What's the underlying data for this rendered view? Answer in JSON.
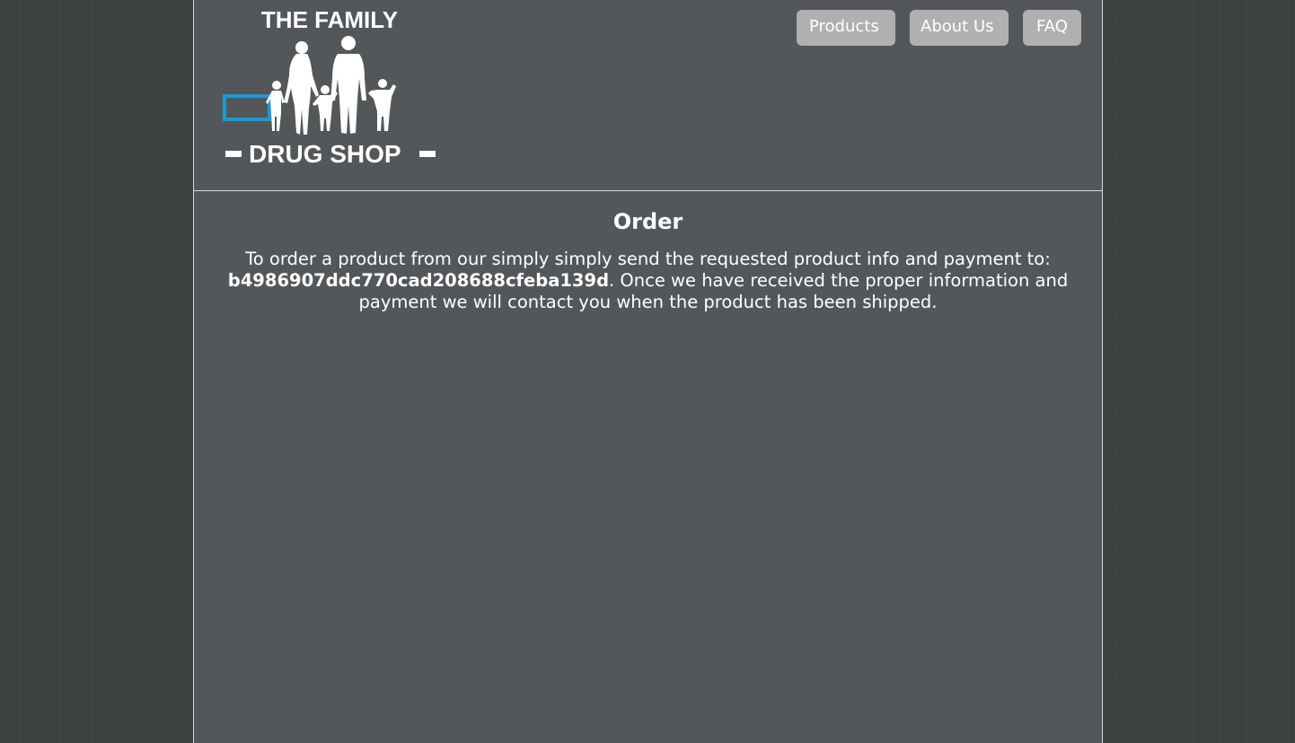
{
  "logo": {
    "line_top": "THE FAMILY",
    "line_bottom": "DRUG SHOP",
    "accent_color": "#1a9ad6"
  },
  "nav": {
    "items": [
      {
        "label": "Products"
      },
      {
        "label": "About Us"
      },
      {
        "label": "FAQ"
      }
    ]
  },
  "main": {
    "heading": "Order",
    "text_before": "To order a product from our simply simply send the requested product info and payment to: ",
    "address": "b4986907ddc770cad208688cfeba139d",
    "text_after": ". Once we have received the proper information and payment we will contact you when the product has been shipped."
  },
  "colors": {
    "background": "#3c413e",
    "panel": "#54575a",
    "button": "#b0b0b0",
    "text": "#ffffff"
  }
}
